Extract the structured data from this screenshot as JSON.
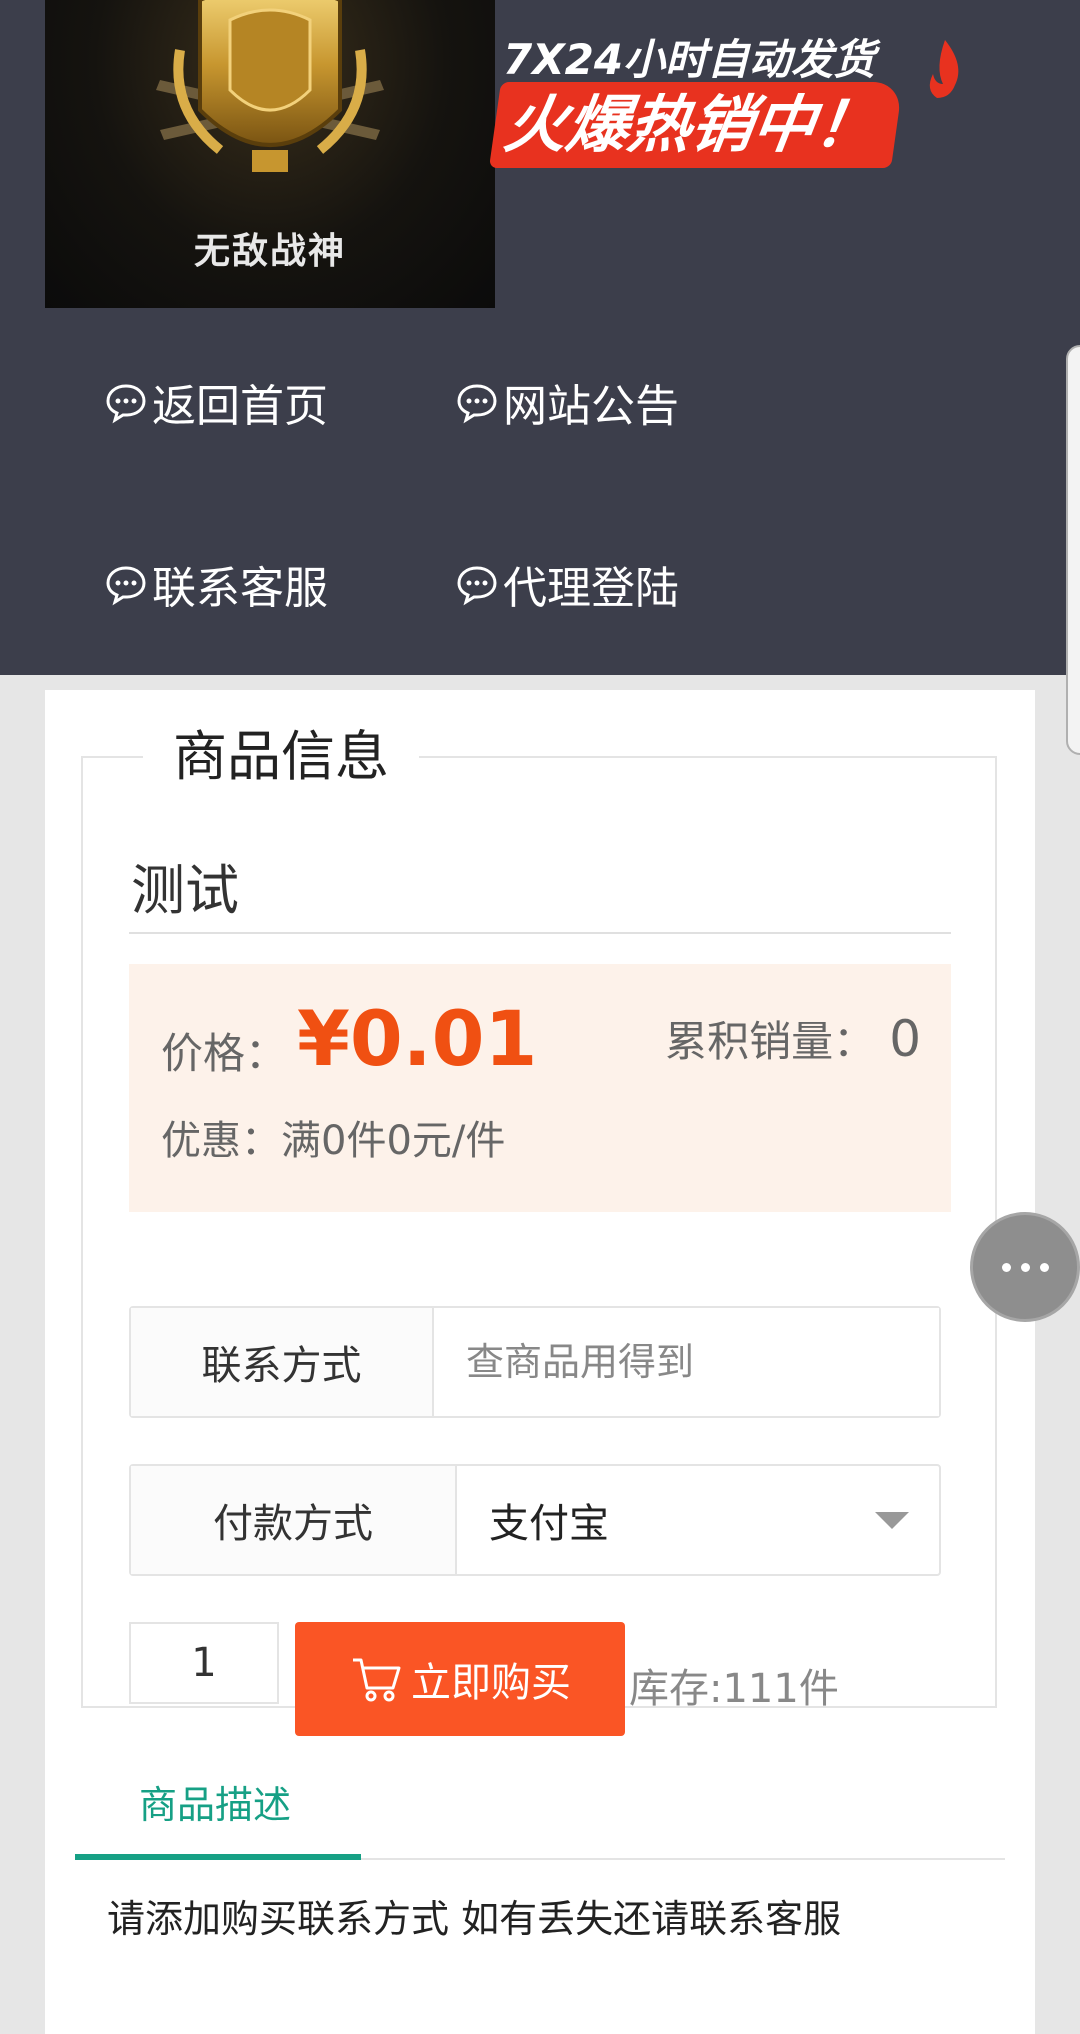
{
  "banner": {
    "badge_text": "无敌战神",
    "promo_line1": "7X24小时自动发货",
    "promo_line2": "火爆热销中！"
  },
  "nav": {
    "items": [
      {
        "label": "返回首页",
        "icon": "chat-bubble-icon"
      },
      {
        "label": "网站公告",
        "icon": "chat-bubble-icon"
      },
      {
        "label": "联系客服",
        "icon": "chat-bubble-icon"
      },
      {
        "label": "代理登陆",
        "icon": "chat-bubble-icon"
      }
    ]
  },
  "product": {
    "section_title": "商品信息",
    "name": "测试",
    "price_label": "价格：",
    "price": "¥0.01",
    "sales_label": "累积销量：",
    "sales_count": "0",
    "discount": "优惠：满0件0元/件"
  },
  "form": {
    "contact_label": "联系方式",
    "contact_placeholder": "查商品用得到",
    "contact_value": "",
    "payment_label": "付款方式",
    "payment_selected": "支付宝"
  },
  "purchase": {
    "quantity": "1",
    "buy_label": "立即购买",
    "stock": "库存:111件"
  },
  "description": {
    "tab_label": "商品描述",
    "text": "请添加购买联系方式 如有丢失还请联系客服"
  },
  "colors": {
    "header_bg": "#3c3e4b",
    "price": "#f05012",
    "buy_button": "#fa5525",
    "tab_accent": "#16a085",
    "price_box_bg": "#fdf2ea"
  }
}
